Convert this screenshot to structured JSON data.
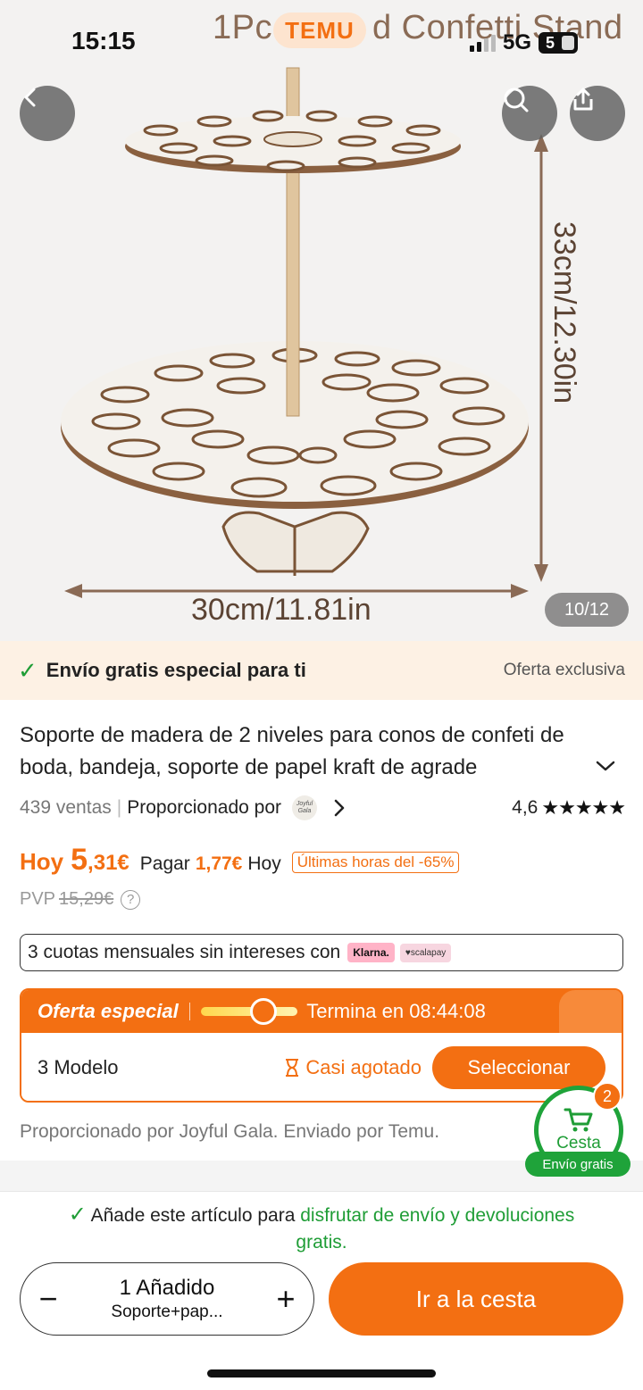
{
  "status_bar": {
    "time": "15:15",
    "network": "5G",
    "battery": "5"
  },
  "hero": {
    "banner_text": "1Pc",
    "banner_text_end": "d Confetti Stand",
    "temu_logo": "TEMU",
    "width_label": "30cm/11.81in",
    "height_label": "33cm/12.30in",
    "counter": "10/12",
    "icons": {
      "back": "chevron-left-icon",
      "search": "search-icon",
      "share": "share-icon"
    }
  },
  "shipping": {
    "main": "Envío gratis especial para ti",
    "aside": "Oferta exclusiva"
  },
  "product": {
    "title": "Soporte de madera de 2 niveles para conos de confeti de boda, bandeja, soporte de papel kraft de agrade",
    "sales": "439 ventas",
    "provided_by": "Proporcionado por",
    "store_logo_text": "Joyful Gala",
    "rating": "4,6",
    "stars": "★★★★★"
  },
  "price": {
    "hoy": "Hoy",
    "amount_int": "5",
    "amount_dec": ",31€",
    "pagar": "Pagar",
    "pagar_amount": "1,77€",
    "pagar_suffix": "Hoy",
    "badge": "Últimas horas del -65%",
    "pvp_label": "PVP",
    "pvp_value": "15,29€"
  },
  "installments": {
    "text": "3 cuotas mensuales sin intereses con",
    "klarna": "Klarna.",
    "scalapay": "♥scalapay"
  },
  "offer": {
    "title": "Oferta especial",
    "ends": "Termina en 08:44:08",
    "progress_fraction": 0.65,
    "model": "3 Modelo",
    "stock": "Casi agotado",
    "select": "Seleccionar"
  },
  "seller_note": "Proporcionado por Joyful Gala. Enviado por Temu.",
  "cart_float": {
    "label": "Cesta",
    "badge": "2",
    "free": "Envío gratis"
  },
  "footer": {
    "note_start": "Añade este artículo para ",
    "note_green": "disfrutar de envío y devoluciones gratis.",
    "qty_main": "1 Añadido",
    "qty_sub": "Soporte+pap...",
    "minus": "−",
    "plus": "+",
    "go_cart": "Ir a la cesta"
  },
  "colors": {
    "accent": "#f36f12",
    "green": "#1f9d36",
    "strip": "#fdf1e4"
  }
}
